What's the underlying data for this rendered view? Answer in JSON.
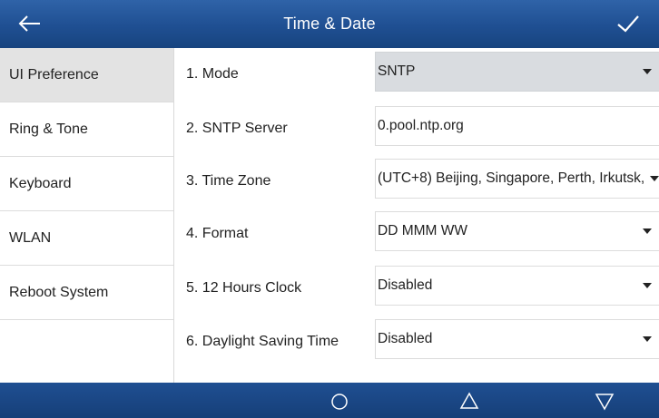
{
  "header": {
    "title": "Time & Date",
    "back_icon": "back-arrow-icon",
    "confirm_icon": "checkmark-icon"
  },
  "sidebar": {
    "items": [
      {
        "label": "UI Preference",
        "active": true
      },
      {
        "label": "Ring & Tone"
      },
      {
        "label": "Keyboard"
      },
      {
        "label": "WLAN"
      },
      {
        "label": "Reboot System"
      }
    ]
  },
  "settings": [
    {
      "label": "1. Mode",
      "value": "SNTP",
      "type": "select",
      "highlighted": true
    },
    {
      "label": "2. SNTP Server",
      "value": "0.pool.ntp.org",
      "type": "text"
    },
    {
      "label": "3. Time Zone",
      "value": "(UTC+8) Beijing, Singapore, Perth, Irkutsk,",
      "type": "select"
    },
    {
      "label": "4. Format",
      "value": "DD MMM WW",
      "type": "select"
    },
    {
      "label": "5. 12 Hours Clock",
      "value": "Disabled",
      "type": "select"
    },
    {
      "label": "6. Daylight Saving Time",
      "value": "Disabled",
      "type": "select"
    }
  ],
  "navbar": {
    "icons": [
      "circle-home-icon",
      "triangle-up-icon",
      "triangle-down-icon"
    ]
  },
  "colors": {
    "header_blue": "#1f4f92",
    "sidebar_active": "#e3e3e3",
    "field_gray": "#d9dce0"
  }
}
